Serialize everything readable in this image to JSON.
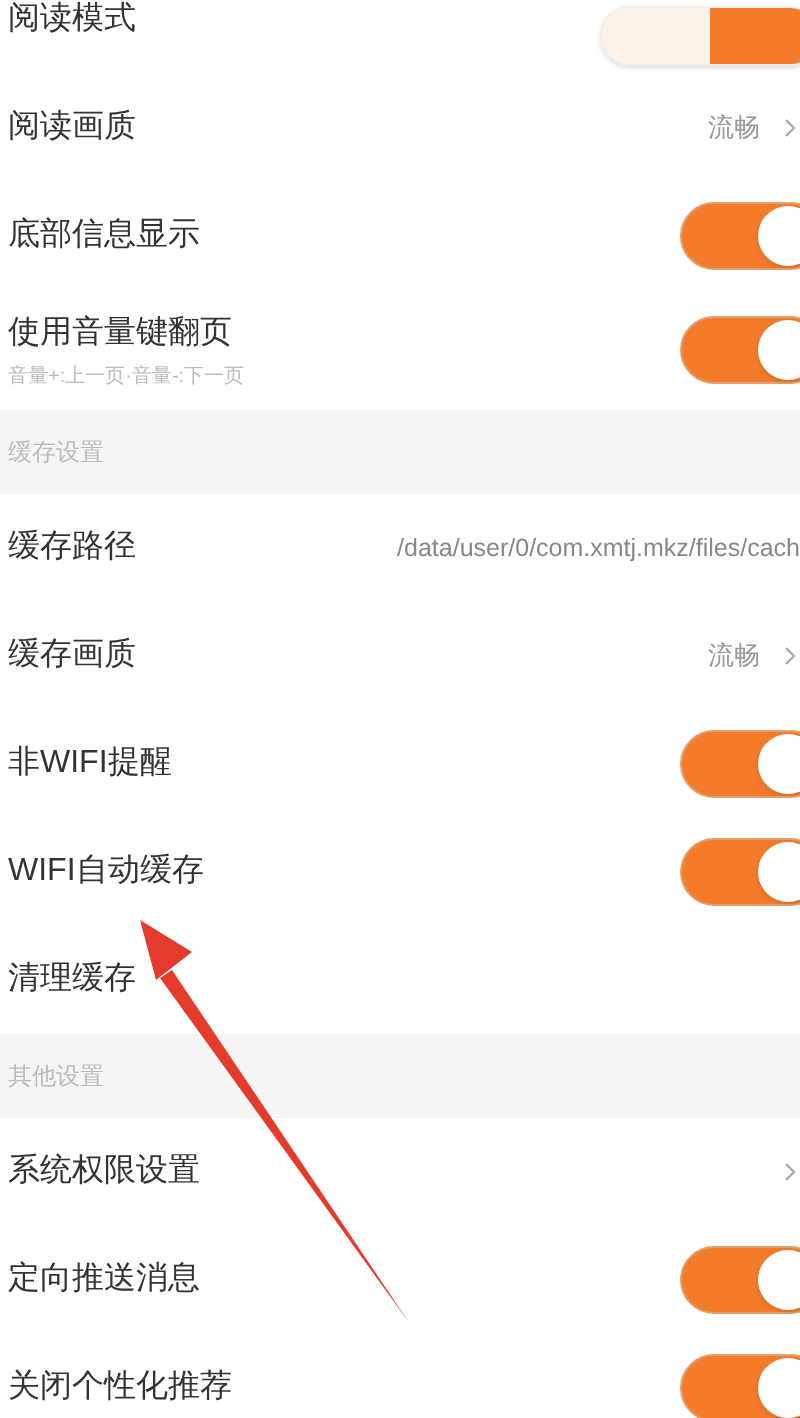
{
  "sections": [
    {
      "rows": [
        {
          "kind": "segmented",
          "label": "阅读模式",
          "on": true
        },
        {
          "kind": "value",
          "label": "阅读画质",
          "value": "流畅"
        },
        {
          "kind": "toggle",
          "label": "底部信息显示",
          "on": true
        },
        {
          "kind": "toggle",
          "label": "使用音量键翻页",
          "subtitle": "音量+:上一页·音量-:下一页",
          "on": true
        }
      ]
    },
    {
      "header": "缓存设置",
      "rows": [
        {
          "kind": "path",
          "label": "缓存路径",
          "value": "/data/user/0/com.xmtj.mkz/files/cach"
        },
        {
          "kind": "value",
          "label": "缓存画质",
          "value": "流畅"
        },
        {
          "kind": "toggle",
          "label": "非WIFI提醒",
          "on": true
        },
        {
          "kind": "toggle",
          "label": "WIFI自动缓存",
          "on": true
        },
        {
          "kind": "plain",
          "label": "清理缓存"
        }
      ]
    },
    {
      "header": "其他设置",
      "rows": [
        {
          "kind": "link",
          "label": "系统权限设置"
        },
        {
          "kind": "toggle",
          "label": "定向推送消息",
          "on": true
        },
        {
          "kind": "toggle",
          "label": "关闭个性化推荐",
          "on": true
        }
      ]
    }
  ]
}
